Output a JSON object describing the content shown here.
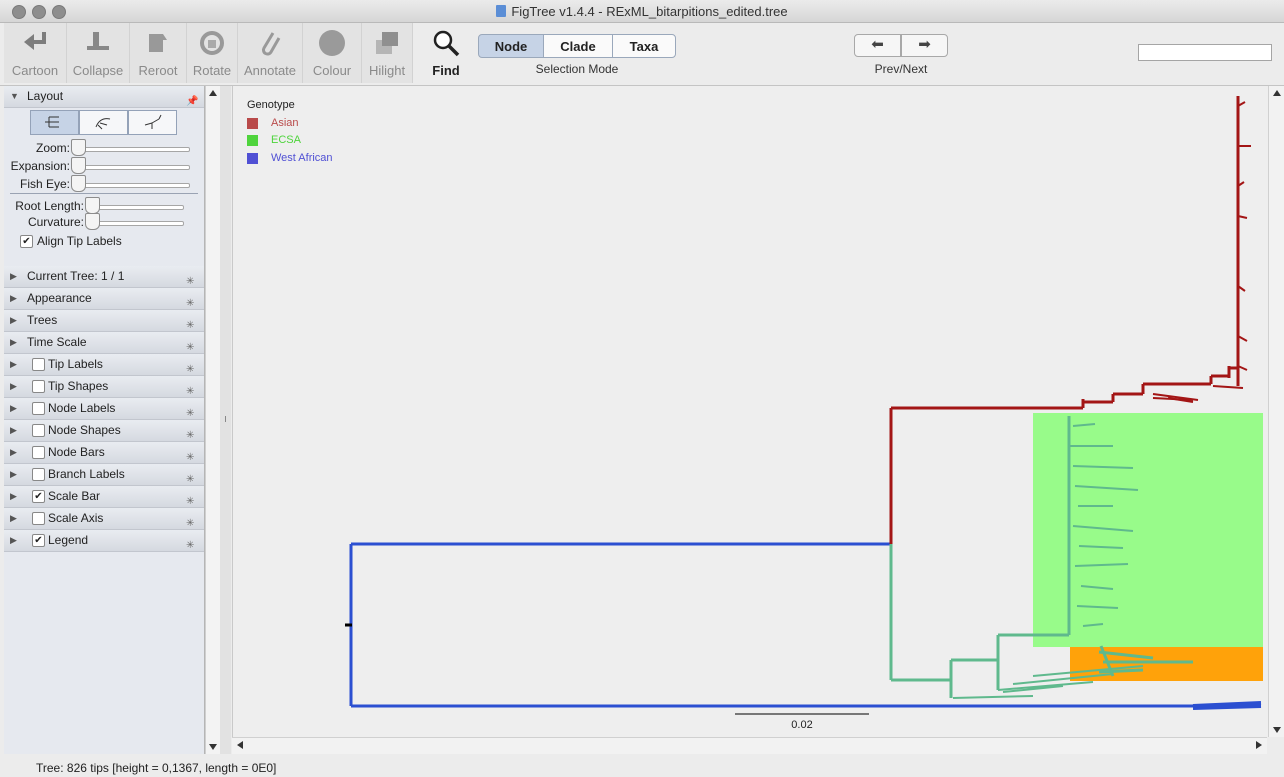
{
  "window": {
    "title": "FigTree v1.4.4 - RExML_bitarpitions_edited.tree"
  },
  "toolbar": {
    "cartoon": "Cartoon",
    "collapse": "Collapse",
    "reroot": "Reroot",
    "rotate": "Rotate",
    "annotate": "Annotate",
    "colour": "Colour",
    "hilight": "Hilight",
    "find": "Find",
    "selection_mode": {
      "node": "Node",
      "clade": "Clade",
      "taxa": "Taxa",
      "active": "Node",
      "caption": "Selection Mode"
    },
    "prevnext_caption": "Prev/Next",
    "search_value": ""
  },
  "layout_panel": {
    "title": "Layout",
    "zoom": "Zoom:",
    "expansion": "Expansion:",
    "fish_eye": "Fish Eye:",
    "root_length": "Root Length:",
    "curvature": "Curvature:",
    "align_tip_labels": "Align Tip Labels",
    "align_checked": true,
    "slider_levels": {
      "zoom": 0,
      "expansion": 0,
      "fish_eye": 0,
      "root_length": 0,
      "curvature": 0
    }
  },
  "sections": [
    {
      "label": "Current Tree: 1 / 1",
      "checkbox": null
    },
    {
      "label": "Appearance",
      "checkbox": null
    },
    {
      "label": "Trees",
      "checkbox": null
    },
    {
      "label": "Time Scale",
      "checkbox": null
    },
    {
      "label": "Tip Labels",
      "checkbox": false
    },
    {
      "label": "Tip Shapes",
      "checkbox": false
    },
    {
      "label": "Node Labels",
      "checkbox": false
    },
    {
      "label": "Node Shapes",
      "checkbox": false
    },
    {
      "label": "Node Bars",
      "checkbox": false
    },
    {
      "label": "Branch Labels",
      "checkbox": false
    },
    {
      "label": "Scale Bar",
      "checkbox": true
    },
    {
      "label": "Scale Axis",
      "checkbox": false
    },
    {
      "label": "Legend",
      "checkbox": true
    }
  ],
  "legend": {
    "title": "Genotype",
    "items": [
      {
        "label": "Asian",
        "color": "#b94a4a"
      },
      {
        "label": "ECSA",
        "color": "#4fd43d"
      },
      {
        "label": "West African",
        "color": "#5050d4"
      }
    ]
  },
  "tree_colors": {
    "asian_branch": "#a31515",
    "ecsa_branch": "#5fb98d",
    "west_african_branch": "#2b4fd1",
    "ecsa_highlight": "#98fb8a",
    "orange_highlight": "#ffa20a"
  },
  "scale_bar": {
    "label": "0.02"
  },
  "status": {
    "text": "Tree: 826 tips [height = 0,1367, length = 0E0]"
  }
}
